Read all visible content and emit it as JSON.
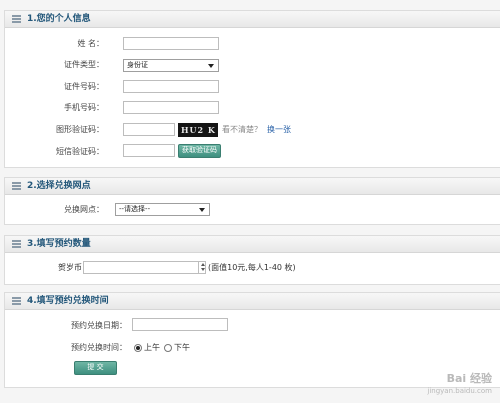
{
  "section1": {
    "title": "1.您的个人信息",
    "name_label": "姓 名：",
    "id_type_label": "证件类型：",
    "id_type_value": "身份证",
    "id_number_label": "证件号码：",
    "phone_label": "手机号码：",
    "captcha_label": "图形验证码：",
    "captcha_text": "HU2 K",
    "unclear_text": "看不清楚？",
    "refresh_link": "换一张",
    "sms_label": "短信验证码：",
    "sms_button": "获取验证码"
  },
  "section2": {
    "title": "2.选择兑换网点",
    "outlet_label": "兑换网点：",
    "outlet_value": "--请选择--"
  },
  "section3": {
    "title": "3.填写预约数量",
    "coin_label": "贺岁币",
    "note": "(面值10元,每人1-40 枚)"
  },
  "section4": {
    "title": "4.填写预约兑换时间",
    "date_label": "预约兑换日期：",
    "time_label": "预约兑换时间：",
    "am_label": "上午",
    "pm_label": "下午",
    "submit_label": "提 交"
  },
  "watermark": {
    "brand": "Bai 经验",
    "url": "jingyan.baidu.com"
  }
}
